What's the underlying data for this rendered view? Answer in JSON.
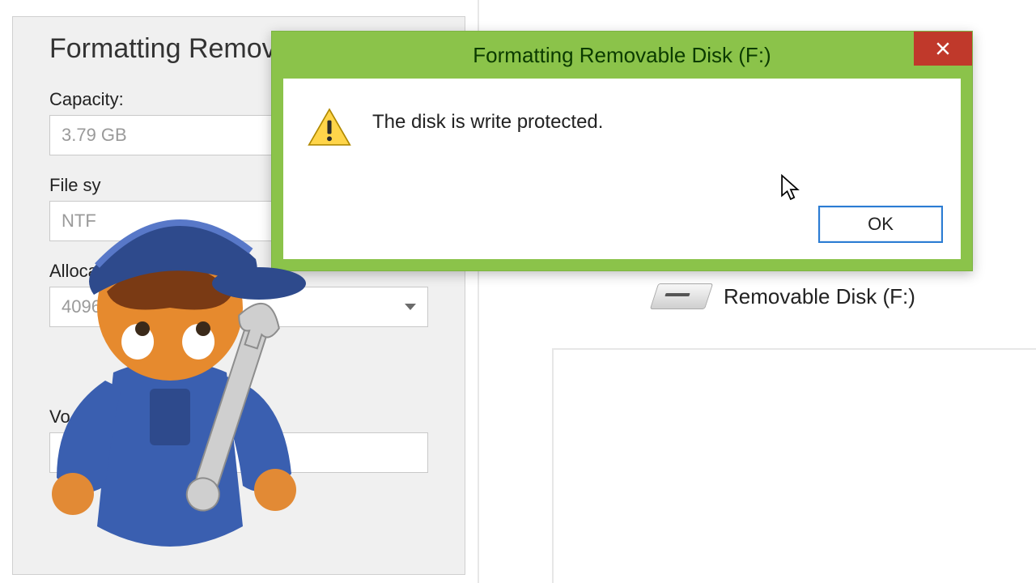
{
  "format_dialog": {
    "title": "Formatting Remov",
    "capacity_label": "Capacity:",
    "capacity_value": "3.79 GB",
    "filesystem_label": "File sy",
    "filesystem_value": "NTF",
    "allocation_label": "Alloca",
    "allocation_value": "4096 b",
    "volume_label": "Vo",
    "volume_value": ""
  },
  "explorer": {
    "drive_label": "Removable Disk (F:)"
  },
  "msgbox": {
    "title": "Formatting Removable Disk (F:)",
    "message": "The disk is write protected.",
    "ok_label": "OK"
  }
}
